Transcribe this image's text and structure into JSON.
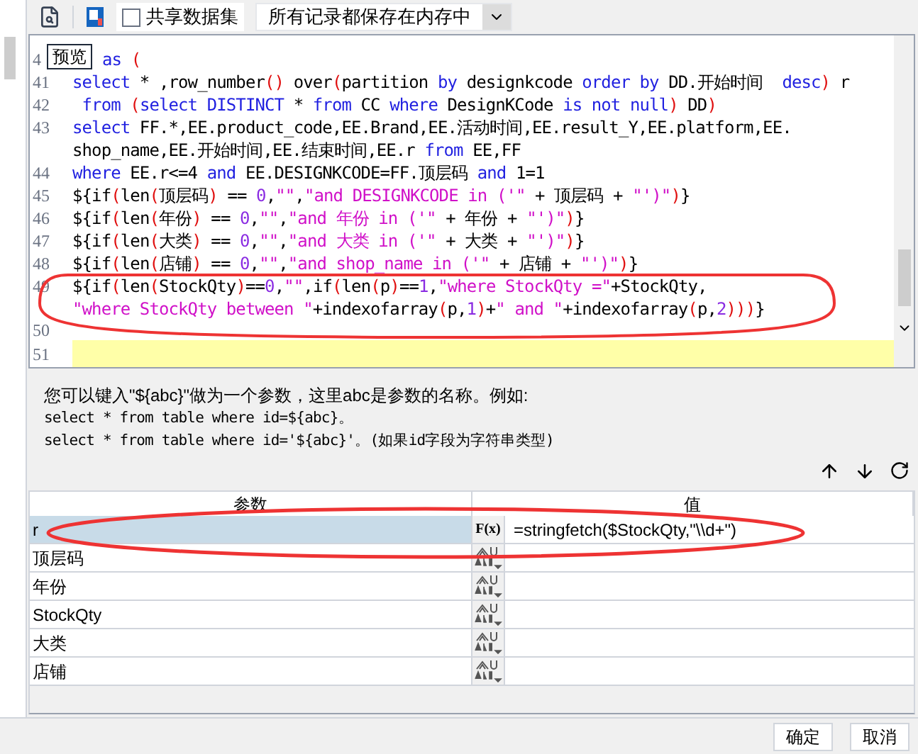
{
  "toolbar": {
    "share_checkbox": {
      "label": "共享数据集",
      "checked": false
    },
    "storage_select": {
      "value": "所有记录都保存在内存中"
    }
  },
  "editor": {
    "tooltip": "预览",
    "lines": [
      {
        "number": "4",
        "tokens": [
          {
            "kind": "keyword",
            "text": "as "
          },
          {
            "kind": "paren",
            "text": "("
          }
        ]
      },
      {
        "number": "41",
        "tokens": [
          {
            "kind": "keyword",
            "text": "select"
          },
          {
            "kind": "plain",
            "text": " * ,row_number"
          },
          {
            "kind": "paren",
            "text": "()"
          },
          {
            "kind": "plain",
            "text": " over"
          },
          {
            "kind": "paren",
            "text": "("
          },
          {
            "kind": "plain",
            "text": "partition "
          },
          {
            "kind": "keyword",
            "text": "by"
          },
          {
            "kind": "plain",
            "text": " designkcode "
          },
          {
            "kind": "keyword",
            "text": "order by"
          },
          {
            "kind": "plain",
            "text": " DD.开始时间  "
          },
          {
            "kind": "keyword",
            "text": "desc"
          },
          {
            "kind": "paren",
            "text": ")"
          },
          {
            "kind": "plain",
            "text": " r"
          }
        ]
      },
      {
        "number": "42",
        "tokens": [
          {
            "kind": "keyword",
            "text": " from "
          },
          {
            "kind": "paren",
            "text": "("
          },
          {
            "kind": "keyword",
            "text": "select DISTINCT"
          },
          {
            "kind": "plain",
            "text": " * "
          },
          {
            "kind": "keyword",
            "text": "from"
          },
          {
            "kind": "plain",
            "text": " CC "
          },
          {
            "kind": "keyword",
            "text": "where"
          },
          {
            "kind": "plain",
            "text": " DesignKCode "
          },
          {
            "kind": "keyword",
            "text": "is not null"
          },
          {
            "kind": "paren",
            "text": ")"
          },
          {
            "kind": "plain",
            "text": " DD"
          },
          {
            "kind": "paren",
            "text": ")"
          }
        ]
      },
      {
        "number": "43",
        "tokens": [
          {
            "kind": "keyword",
            "text": "select"
          },
          {
            "kind": "plain",
            "text": " FF.*,EE.product_code,EE.Brand,EE.活动时间,EE.result_Y,EE.platform,EE."
          }
        ]
      },
      {
        "tokens": [
          {
            "kind": "plain",
            "text": "shop_name,EE.开始时间,EE.结束时间,EE.r "
          },
          {
            "kind": "keyword",
            "text": "from"
          },
          {
            "kind": "plain",
            "text": " EE,FF"
          }
        ]
      },
      {
        "number": "44",
        "tokens": [
          {
            "kind": "keyword",
            "text": "where"
          },
          {
            "kind": "plain",
            "text": " EE.r<=4 "
          },
          {
            "kind": "keyword",
            "text": "and"
          },
          {
            "kind": "plain",
            "text": " EE.DESIGNKCODE=FF.顶层码 "
          },
          {
            "kind": "keyword",
            "text": "and"
          },
          {
            "kind": "plain",
            "text": " 1=1"
          }
        ]
      },
      {
        "number": "45",
        "tokens": [
          {
            "kind": "plain",
            "text": "${if"
          },
          {
            "kind": "paren",
            "text": "("
          },
          {
            "kind": "plain",
            "text": "len"
          },
          {
            "kind": "paren",
            "text": "("
          },
          {
            "kind": "plain",
            "text": "顶层码"
          },
          {
            "kind": "paren",
            "text": ")"
          },
          {
            "kind": "plain",
            "text": " == "
          },
          {
            "kind": "number",
            "text": "0"
          },
          {
            "kind": "plain",
            "text": ","
          },
          {
            "kind": "string",
            "text": "\"\""
          },
          {
            "kind": "plain",
            "text": ","
          },
          {
            "kind": "string",
            "text": "\"and DESIGNKCODE in ('\""
          },
          {
            "kind": "plain",
            "text": " + 顶层码 + "
          },
          {
            "kind": "string",
            "text": "\"')\""
          },
          {
            "kind": "paren",
            "text": ")"
          },
          {
            "kind": "plain",
            "text": "}"
          }
        ]
      },
      {
        "number": "46",
        "tokens": [
          {
            "kind": "plain",
            "text": "${if"
          },
          {
            "kind": "paren",
            "text": "("
          },
          {
            "kind": "plain",
            "text": "len"
          },
          {
            "kind": "paren",
            "text": "("
          },
          {
            "kind": "plain",
            "text": "年份"
          },
          {
            "kind": "paren",
            "text": ")"
          },
          {
            "kind": "plain",
            "text": " == "
          },
          {
            "kind": "number",
            "text": "0"
          },
          {
            "kind": "plain",
            "text": ","
          },
          {
            "kind": "string",
            "text": "\"\""
          },
          {
            "kind": "plain",
            "text": ","
          },
          {
            "kind": "string",
            "text": "\"and 年份 in ('\""
          },
          {
            "kind": "plain",
            "text": " + 年份 + "
          },
          {
            "kind": "string",
            "text": "\"')\""
          },
          {
            "kind": "paren",
            "text": ")"
          },
          {
            "kind": "plain",
            "text": "}"
          }
        ]
      },
      {
        "number": "47",
        "tokens": [
          {
            "kind": "plain",
            "text": "${if"
          },
          {
            "kind": "paren",
            "text": "("
          },
          {
            "kind": "plain",
            "text": "len"
          },
          {
            "kind": "paren",
            "text": "("
          },
          {
            "kind": "plain",
            "text": "大类"
          },
          {
            "kind": "paren",
            "text": ")"
          },
          {
            "kind": "plain",
            "text": " == "
          },
          {
            "kind": "number",
            "text": "0"
          },
          {
            "kind": "plain",
            "text": ","
          },
          {
            "kind": "string",
            "text": "\"\""
          },
          {
            "kind": "plain",
            "text": ","
          },
          {
            "kind": "string",
            "text": "\"and 大类 in ('\""
          },
          {
            "kind": "plain",
            "text": " + 大类 + "
          },
          {
            "kind": "string",
            "text": "\"')\""
          },
          {
            "kind": "paren",
            "text": ")"
          },
          {
            "kind": "plain",
            "text": "}"
          }
        ]
      },
      {
        "number": "48",
        "tokens": [
          {
            "kind": "plain",
            "text": "${if"
          },
          {
            "kind": "paren",
            "text": "("
          },
          {
            "kind": "plain",
            "text": "len"
          },
          {
            "kind": "paren",
            "text": "("
          },
          {
            "kind": "plain",
            "text": "店铺"
          },
          {
            "kind": "paren",
            "text": ")"
          },
          {
            "kind": "plain",
            "text": " == "
          },
          {
            "kind": "number",
            "text": "0"
          },
          {
            "kind": "plain",
            "text": ","
          },
          {
            "kind": "string",
            "text": "\"\""
          },
          {
            "kind": "plain",
            "text": ","
          },
          {
            "kind": "string",
            "text": "\"and shop_name in ('\""
          },
          {
            "kind": "plain",
            "text": " + 店铺 + "
          },
          {
            "kind": "string",
            "text": "\"')\""
          },
          {
            "kind": "paren",
            "text": ")"
          },
          {
            "kind": "plain",
            "text": "}"
          }
        ]
      },
      {
        "number": "49",
        "tokens": [
          {
            "kind": "plain",
            "text": "${if"
          },
          {
            "kind": "paren",
            "text": "("
          },
          {
            "kind": "plain",
            "text": "len"
          },
          {
            "kind": "paren",
            "text": "("
          },
          {
            "kind": "plain",
            "text": "StockQty"
          },
          {
            "kind": "paren",
            "text": ")"
          },
          {
            "kind": "plain",
            "text": "=="
          },
          {
            "kind": "number",
            "text": "0"
          },
          {
            "kind": "plain",
            "text": ","
          },
          {
            "kind": "string",
            "text": "\"\""
          },
          {
            "kind": "plain",
            "text": ",if"
          },
          {
            "kind": "paren",
            "text": "("
          },
          {
            "kind": "plain",
            "text": "len"
          },
          {
            "kind": "paren",
            "text": "("
          },
          {
            "kind": "plain",
            "text": "p"
          },
          {
            "kind": "paren",
            "text": ")"
          },
          {
            "kind": "plain",
            "text": "=="
          },
          {
            "kind": "number",
            "text": "1"
          },
          {
            "kind": "plain",
            "text": ","
          },
          {
            "kind": "string",
            "text": "\"where StockQty =\""
          },
          {
            "kind": "plain",
            "text": "+StockQty,"
          }
        ]
      },
      {
        "tokens": [
          {
            "kind": "string",
            "text": "\"where StockQty between \""
          },
          {
            "kind": "plain",
            "text": "+indexofarray"
          },
          {
            "kind": "paren",
            "text": "("
          },
          {
            "kind": "plain",
            "text": "p,"
          },
          {
            "kind": "number",
            "text": "1"
          },
          {
            "kind": "paren",
            "text": ")"
          },
          {
            "kind": "plain",
            "text": "+"
          },
          {
            "kind": "string",
            "text": "\" and \""
          },
          {
            "kind": "plain",
            "text": "+indexofarray"
          },
          {
            "kind": "paren",
            "text": "("
          },
          {
            "kind": "plain",
            "text": "p,"
          },
          {
            "kind": "number",
            "text": "2"
          },
          {
            "kind": "paren",
            "text": ")))"
          },
          {
            "kind": "plain",
            "text": "}"
          }
        ]
      },
      {
        "number": "50",
        "current": false
      },
      {
        "number": "51",
        "current": true
      }
    ]
  },
  "help": [
    "您可以键入\"${abc}\"做为一个参数，这里abc是参数的名称。例如:",
    "select * from table where id=${abc}。",
    "select * from table where id='${abc}'。(如果id字段为字符串类型)"
  ],
  "params_table": {
    "columns": [
      "参数",
      "值"
    ],
    "rows": [
      {
        "name": "r",
        "kind": "formula",
        "type_label": "F(x)",
        "value": "=stringfetch($StockQty,\"\\\\d+\")",
        "selected": true
      },
      {
        "name": "顶层码",
        "kind": "text",
        "selected": false
      },
      {
        "name": "年份",
        "kind": "text",
        "selected": false
      },
      {
        "name": "StockQty",
        "kind": "text",
        "selected": false
      },
      {
        "name": "大类",
        "kind": "text",
        "selected": false
      },
      {
        "name": "店铺",
        "kind": "text",
        "selected": false
      }
    ]
  },
  "buttons": [
    "确定",
    "取消"
  ]
}
